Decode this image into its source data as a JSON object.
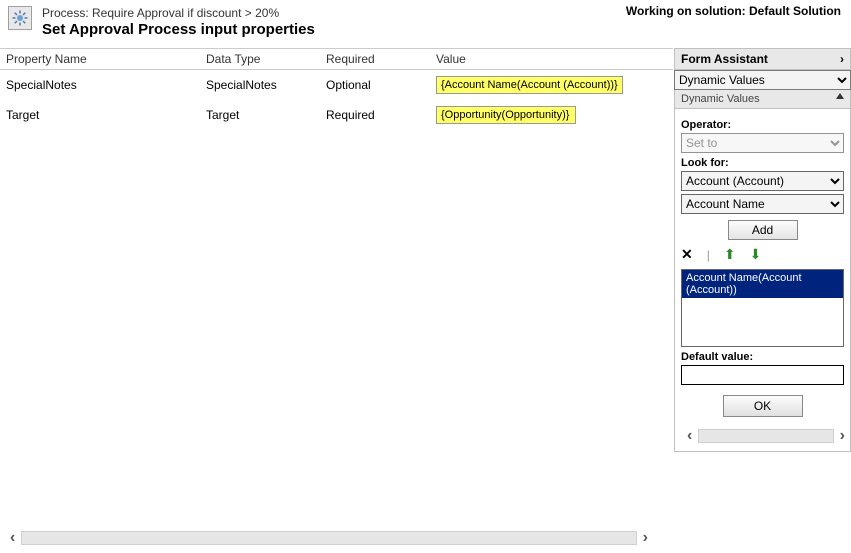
{
  "header": {
    "process_prefix": "Process: ",
    "process_name": "Require Approval if discount > 20%",
    "title": "Set Approval Process input properties",
    "solution_prefix": "Working on solution: ",
    "solution_name": "Default Solution"
  },
  "grid": {
    "columns": {
      "property": "Property Name",
      "datatype": "Data Type",
      "required": "Required",
      "value": "Value"
    },
    "rows": [
      {
        "property": "SpecialNotes",
        "datatype": "SpecialNotes",
        "required": "Optional",
        "value": "{Account Name(Account (Account))}"
      },
      {
        "property": "Target",
        "datatype": "Target",
        "required": "Required",
        "value": "{Opportunity(Opportunity)}"
      }
    ]
  },
  "assistant": {
    "title": "Form Assistant",
    "mode": "Dynamic Values",
    "section": "Dynamic Values",
    "operator_label": "Operator:",
    "operator_value": "Set to",
    "lookfor_label": "Look for:",
    "lookfor_entity": "Account (Account)",
    "lookfor_attr": "Account Name",
    "add_label": "Add",
    "selected_item": "Account Name(Account (Account))",
    "default_label": "Default value:",
    "default_value": "",
    "ok_label": "OK"
  }
}
